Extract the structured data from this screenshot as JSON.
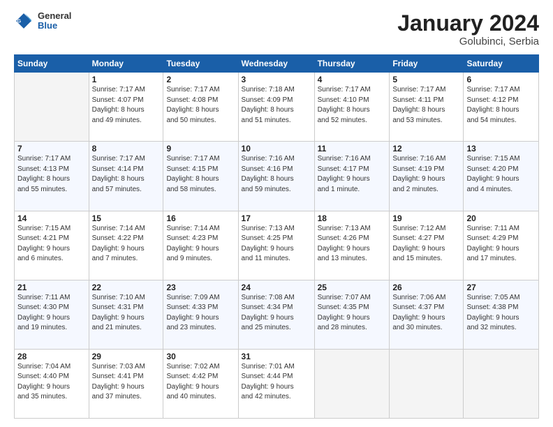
{
  "header": {
    "logo_general": "General",
    "logo_blue": "Blue",
    "title": "January 2024",
    "location": "Golubinci, Serbia"
  },
  "days_of_week": [
    "Sunday",
    "Monday",
    "Tuesday",
    "Wednesday",
    "Thursday",
    "Friday",
    "Saturday"
  ],
  "weeks": [
    [
      {
        "num": "",
        "detail": ""
      },
      {
        "num": "1",
        "detail": "Sunrise: 7:17 AM\nSunset: 4:07 PM\nDaylight: 8 hours\nand 49 minutes."
      },
      {
        "num": "2",
        "detail": "Sunrise: 7:17 AM\nSunset: 4:08 PM\nDaylight: 8 hours\nand 50 minutes."
      },
      {
        "num": "3",
        "detail": "Sunrise: 7:18 AM\nSunset: 4:09 PM\nDaylight: 8 hours\nand 51 minutes."
      },
      {
        "num": "4",
        "detail": "Sunrise: 7:17 AM\nSunset: 4:10 PM\nDaylight: 8 hours\nand 52 minutes."
      },
      {
        "num": "5",
        "detail": "Sunrise: 7:17 AM\nSunset: 4:11 PM\nDaylight: 8 hours\nand 53 minutes."
      },
      {
        "num": "6",
        "detail": "Sunrise: 7:17 AM\nSunset: 4:12 PM\nDaylight: 8 hours\nand 54 minutes."
      }
    ],
    [
      {
        "num": "7",
        "detail": "Sunrise: 7:17 AM\nSunset: 4:13 PM\nDaylight: 8 hours\nand 55 minutes."
      },
      {
        "num": "8",
        "detail": "Sunrise: 7:17 AM\nSunset: 4:14 PM\nDaylight: 8 hours\nand 57 minutes."
      },
      {
        "num": "9",
        "detail": "Sunrise: 7:17 AM\nSunset: 4:15 PM\nDaylight: 8 hours\nand 58 minutes."
      },
      {
        "num": "10",
        "detail": "Sunrise: 7:16 AM\nSunset: 4:16 PM\nDaylight: 8 hours\nand 59 minutes."
      },
      {
        "num": "11",
        "detail": "Sunrise: 7:16 AM\nSunset: 4:17 PM\nDaylight: 9 hours\nand 1 minute."
      },
      {
        "num": "12",
        "detail": "Sunrise: 7:16 AM\nSunset: 4:19 PM\nDaylight: 9 hours\nand 2 minutes."
      },
      {
        "num": "13",
        "detail": "Sunrise: 7:15 AM\nSunset: 4:20 PM\nDaylight: 9 hours\nand 4 minutes."
      }
    ],
    [
      {
        "num": "14",
        "detail": "Sunrise: 7:15 AM\nSunset: 4:21 PM\nDaylight: 9 hours\nand 6 minutes."
      },
      {
        "num": "15",
        "detail": "Sunrise: 7:14 AM\nSunset: 4:22 PM\nDaylight: 9 hours\nand 7 minutes."
      },
      {
        "num": "16",
        "detail": "Sunrise: 7:14 AM\nSunset: 4:23 PM\nDaylight: 9 hours\nand 9 minutes."
      },
      {
        "num": "17",
        "detail": "Sunrise: 7:13 AM\nSunset: 4:25 PM\nDaylight: 9 hours\nand 11 minutes."
      },
      {
        "num": "18",
        "detail": "Sunrise: 7:13 AM\nSunset: 4:26 PM\nDaylight: 9 hours\nand 13 minutes."
      },
      {
        "num": "19",
        "detail": "Sunrise: 7:12 AM\nSunset: 4:27 PM\nDaylight: 9 hours\nand 15 minutes."
      },
      {
        "num": "20",
        "detail": "Sunrise: 7:11 AM\nSunset: 4:29 PM\nDaylight: 9 hours\nand 17 minutes."
      }
    ],
    [
      {
        "num": "21",
        "detail": "Sunrise: 7:11 AM\nSunset: 4:30 PM\nDaylight: 9 hours\nand 19 minutes."
      },
      {
        "num": "22",
        "detail": "Sunrise: 7:10 AM\nSunset: 4:31 PM\nDaylight: 9 hours\nand 21 minutes."
      },
      {
        "num": "23",
        "detail": "Sunrise: 7:09 AM\nSunset: 4:33 PM\nDaylight: 9 hours\nand 23 minutes."
      },
      {
        "num": "24",
        "detail": "Sunrise: 7:08 AM\nSunset: 4:34 PM\nDaylight: 9 hours\nand 25 minutes."
      },
      {
        "num": "25",
        "detail": "Sunrise: 7:07 AM\nSunset: 4:35 PM\nDaylight: 9 hours\nand 28 minutes."
      },
      {
        "num": "26",
        "detail": "Sunrise: 7:06 AM\nSunset: 4:37 PM\nDaylight: 9 hours\nand 30 minutes."
      },
      {
        "num": "27",
        "detail": "Sunrise: 7:05 AM\nSunset: 4:38 PM\nDaylight: 9 hours\nand 32 minutes."
      }
    ],
    [
      {
        "num": "28",
        "detail": "Sunrise: 7:04 AM\nSunset: 4:40 PM\nDaylight: 9 hours\nand 35 minutes."
      },
      {
        "num": "29",
        "detail": "Sunrise: 7:03 AM\nSunset: 4:41 PM\nDaylight: 9 hours\nand 37 minutes."
      },
      {
        "num": "30",
        "detail": "Sunrise: 7:02 AM\nSunset: 4:42 PM\nDaylight: 9 hours\nand 40 minutes."
      },
      {
        "num": "31",
        "detail": "Sunrise: 7:01 AM\nSunset: 4:44 PM\nDaylight: 9 hours\nand 42 minutes."
      },
      {
        "num": "",
        "detail": ""
      },
      {
        "num": "",
        "detail": ""
      },
      {
        "num": "",
        "detail": ""
      }
    ]
  ]
}
